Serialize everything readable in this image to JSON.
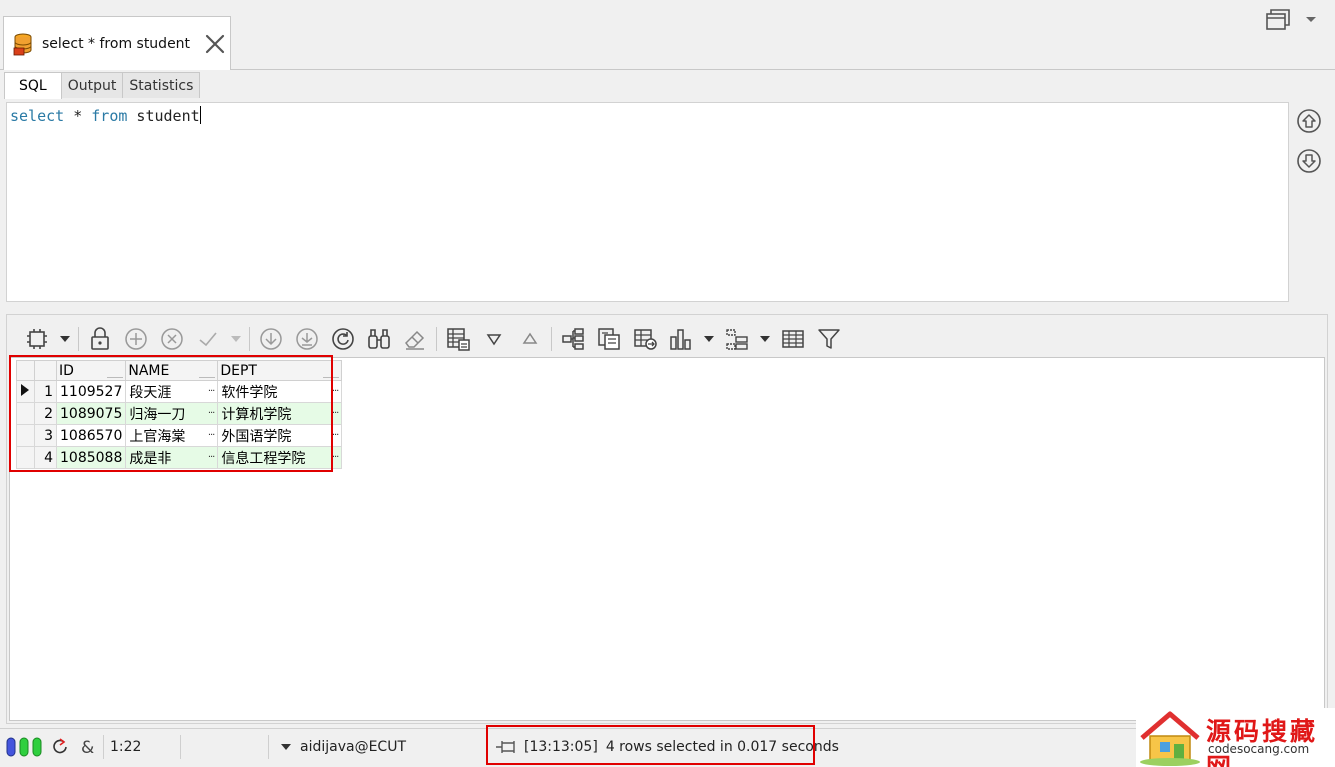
{
  "doc_tab": {
    "label": "select * from student"
  },
  "sub_tabs": [
    {
      "label": "SQL",
      "active": true
    },
    {
      "label": "Output",
      "active": false
    },
    {
      "label": "Statistics",
      "active": false
    }
  ],
  "editor": {
    "tokens": [
      {
        "text": "select",
        "kind": "keyword"
      },
      {
        "text": " * ",
        "kind": "plain"
      },
      {
        "text": "from",
        "kind": "keyword"
      },
      {
        "text": " student",
        "kind": "plain"
      }
    ],
    "keyword_color": "#2a7aa5"
  },
  "grid": {
    "columns": [
      "ID",
      "NAME",
      "DEPT"
    ],
    "rows": [
      {
        "num": "1",
        "id": "1109527",
        "name": "段天涯",
        "dept": "软件学院",
        "current": true
      },
      {
        "num": "2",
        "id": "1089075",
        "name": "归海一刀",
        "dept": "计算机学院",
        "current": false
      },
      {
        "num": "3",
        "id": "1086570",
        "name": "上官海棠",
        "dept": "外国语学院",
        "current": false
      },
      {
        "num": "4",
        "id": "1085088",
        "name": "成是非",
        "dept": "信息工程学院",
        "current": false
      }
    ],
    "alt_row_color": "#e6fbe6",
    "cell_more_glyph": "···"
  },
  "toolbar_icons": [
    "grid-mode-icon",
    "dropdown-icon",
    "lock-icon",
    "add-row-icon",
    "delete-row-icon",
    "post-icon",
    "dropdown-icon",
    "fetch-next-icon",
    "fetch-all-icon",
    "refresh-icon",
    "find-icon",
    "clear-icon",
    "single-record-icon",
    "sort-desc-icon",
    "sort-asc-icon",
    "tree-icon",
    "copy-icon",
    "export-icon",
    "chart-icon",
    "dropdown-icon",
    "group-icon",
    "dropdown-icon",
    "table-view-icon",
    "filter-icon"
  ],
  "status_bar": {
    "position": "1:22",
    "connection": "aidijava@ECUT",
    "timestamp": "[13:13:05]",
    "message": "4 rows selected in 0.017 seconds"
  },
  "watermark": {
    "title": "源码搜藏网",
    "subtitle": "codesocang.com"
  },
  "highlight_color": "#e00000"
}
